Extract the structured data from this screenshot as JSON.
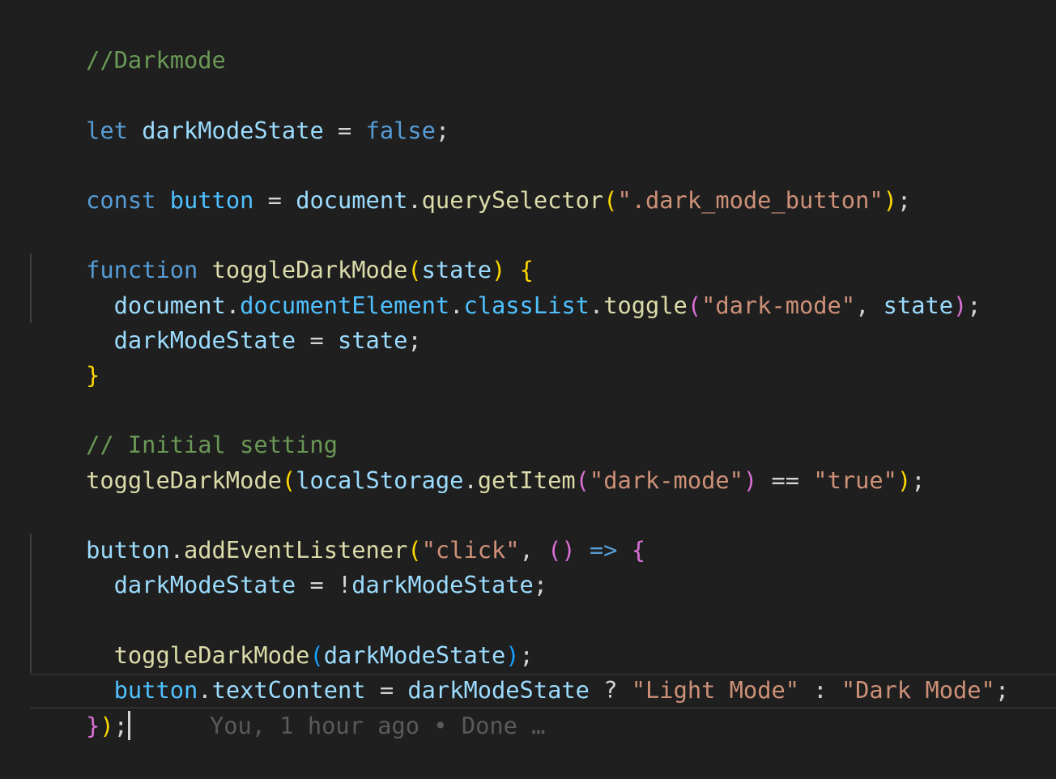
{
  "editor": {
    "lines": {
      "l1": [
        "//Darkmode"
      ],
      "l2": [
        "let",
        " ",
        "darkModeState",
        " = ",
        "false",
        ";"
      ],
      "l3": [
        "const",
        " ",
        "button",
        " = ",
        "document",
        ".",
        "querySelector",
        "(",
        "\".dark_mode_button\"",
        ")",
        ";"
      ],
      "l4": [
        "function",
        " ",
        "toggleDarkMode",
        "(",
        "state",
        ")",
        " ",
        "{"
      ],
      "l5": [
        "  ",
        "document",
        ".",
        "documentElement",
        ".",
        "classList",
        ".",
        "toggle",
        "(",
        "\"dark-mode\"",
        ", ",
        "state",
        ")",
        ";"
      ],
      "l6": [
        "  ",
        "darkModeState",
        " = ",
        "state",
        ";"
      ],
      "l7": [
        "}"
      ],
      "l8": [
        "// Initial setting"
      ],
      "l9": [
        "toggleDarkMode",
        "(",
        "localStorage",
        ".",
        "getItem",
        "(",
        "\"dark-mode\"",
        ")",
        " == ",
        "\"true\"",
        ")",
        ";"
      ],
      "l10": [
        "button",
        ".",
        "addEventListener",
        "(",
        "\"click\"",
        ", ",
        "()",
        " => ",
        "{"
      ],
      "l11": [
        "  ",
        "darkModeState",
        " = !",
        "darkModeState",
        ";"
      ],
      "l12": [
        "  ",
        "toggleDarkMode",
        "(",
        "darkModeState",
        ")",
        ";"
      ],
      "l13": [
        "  ",
        "button",
        ".",
        "textContent",
        " = ",
        "darkModeState",
        " ? ",
        "\"Light Mode\"",
        " : ",
        "\"Dark Mode\"",
        ";"
      ],
      "l14": [
        "}",
        ")",
        ";"
      ]
    },
    "blame_text": "You, 1 hour ago • Done …",
    "colors": {
      "background": "#1f1f1f",
      "comment": "#6a9955",
      "keyword": "#569cd6",
      "variable": "#9cdcfe",
      "constant": "#4fc1ff",
      "function": "#dcdcaa",
      "string": "#ce9178",
      "bracket_level1": "#ffd700",
      "bracket_level2": "#da70d6",
      "bracket_level3": "#179fff",
      "blame": "#5a5a5a"
    }
  }
}
